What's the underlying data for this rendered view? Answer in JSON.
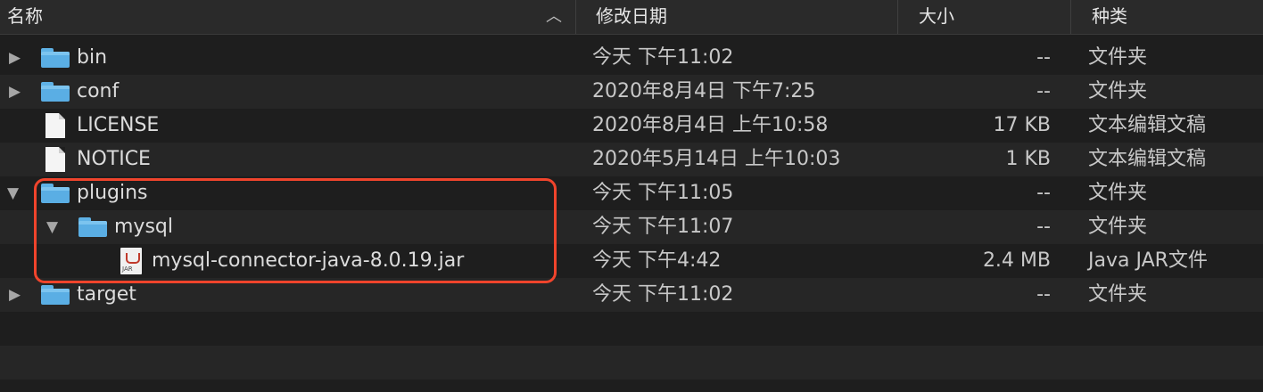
{
  "columns": {
    "name": "名称",
    "date": "修改日期",
    "size": "大小",
    "kind": "种类"
  },
  "rows": [
    {
      "name": "bin",
      "date": "今天 下午11:02",
      "size": "--",
      "kind": "文件夹",
      "icon": "folder-icon",
      "expand": "collapsed"
    },
    {
      "name": "conf",
      "date": "2020年8月4日 下午7:25",
      "size": "--",
      "kind": "文件夹",
      "icon": "folder-icon",
      "expand": "collapsed"
    },
    {
      "name": "LICENSE",
      "date": "2020年8月4日 上午10:58",
      "size": "17 KB",
      "kind": "文本编辑文稿",
      "icon": "document-icon"
    },
    {
      "name": "NOTICE",
      "date": "2020年5月14日 上午10:03",
      "size": "1 KB",
      "kind": "文本编辑文稿",
      "icon": "document-icon"
    },
    {
      "name": "plugins",
      "date": "今天 下午11:05",
      "size": "--",
      "kind": "文件夹",
      "icon": "folder-icon",
      "expand": "expanded"
    },
    {
      "name": "mysql",
      "date": "今天 下午11:07",
      "size": "--",
      "kind": "文件夹",
      "icon": "folder-icon",
      "expand": "expanded"
    },
    {
      "name": "mysql-connector-java-8.0.19.jar",
      "date": "今天 下午4:42",
      "size": "2.4 MB",
      "kind": "Java JAR文件",
      "icon": "jar-icon"
    },
    {
      "name": "target",
      "date": "今天 下午11:02",
      "size": "--",
      "kind": "文件夹",
      "icon": "folder-icon",
      "expand": "collapsed"
    }
  ],
  "jar_icon_label": "JAR",
  "colors": {
    "folder": "#5aaee4",
    "highlight": "#f0442c",
    "background": "#1e1e1e"
  }
}
